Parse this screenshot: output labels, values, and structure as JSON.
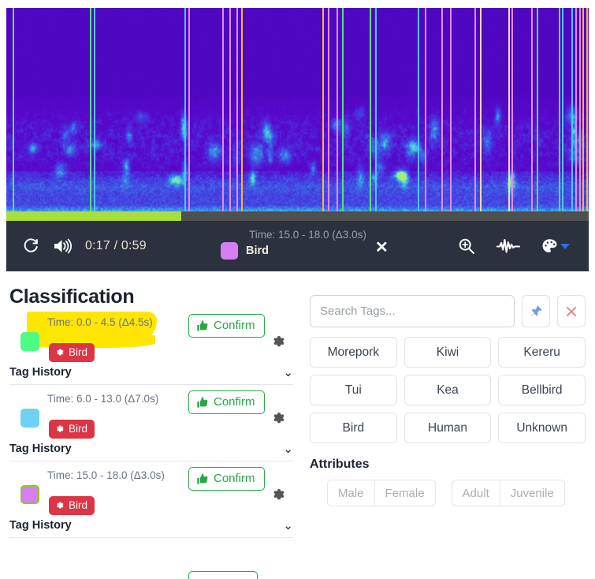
{
  "player": {
    "replay_icon": "replay-icon",
    "volume_icon": "volume-high-icon",
    "time_display": "0:17 / 0:59",
    "current_time": "0:17",
    "total_time": "0:59",
    "progress_percent": 30,
    "selection": {
      "time_label": "Time: 15.0 - 18.0 (Δ3.0s)",
      "tag_label": "Bird",
      "swatch_color": "#d77ff0",
      "clear_icon": "close-icon"
    },
    "tools": [
      {
        "name": "zoom-in-icon",
        "label": "Zoom"
      },
      {
        "name": "waveform-icon",
        "label": "Waveform"
      },
      {
        "name": "palette-icon",
        "label": "Colour map"
      }
    ],
    "regions": [
      {
        "left_pct": 1.1,
        "width_pct": 13.5,
        "color": "#58e27a"
      },
      {
        "left_pct": 15.0,
        "width_pct": 15.8,
        "color": "#4fc3f7"
      },
      {
        "left_pct": 31.2,
        "width_pct": 6.2,
        "color": "#e48ae8"
      },
      {
        "left_pct": 38.3,
        "width_pct": 1.5,
        "color": "#e48ae8"
      },
      {
        "left_pct": 40.3,
        "width_pct": 14.2,
        "color": "#ffb347"
      },
      {
        "left_pct": 55.2,
        "width_pct": 1.8,
        "color": "#e48ae8"
      },
      {
        "left_pct": 57.6,
        "width_pct": 5.0,
        "color": "#58e27a"
      },
      {
        "left_pct": 63.3,
        "width_pct": 7.6,
        "color": "#4fc3f7"
      },
      {
        "left_pct": 71.9,
        "width_pct": 3.1,
        "color": "#e48ae8"
      },
      {
        "left_pct": 76.2,
        "width_pct": 4.4,
        "color": "#e48ae8"
      },
      {
        "left_pct": 81.3,
        "width_pct": 5.2,
        "color": "#ffd9a0"
      },
      {
        "left_pct": 86.8,
        "width_pct": 3.6,
        "color": "#e48ae8"
      },
      {
        "left_pct": 91.1,
        "width_pct": 4.0,
        "color": "#58e27a"
      },
      {
        "left_pct": 95.4,
        "width_pct": 1.9,
        "color": "#4fc3f7"
      },
      {
        "left_pct": 97.7,
        "width_pct": 1.0,
        "color": "#e48ae8"
      },
      {
        "left_pct": 98.9,
        "width_pct": 0.9,
        "color": "#ffb347"
      }
    ]
  },
  "classification": {
    "title": "Classification",
    "rows": [
      {
        "time": "Time: 0.0 - 4.5 (Δ4.5s)",
        "tag": "Bird",
        "swatch_color": "#4dfc82",
        "selected": false,
        "highlighted": true,
        "confirm_label": "Confirm",
        "tag_history_label": "Tag History"
      },
      {
        "time": "Time: 6.0 - 13.0 (Δ7.0s)",
        "tag": "Bird",
        "swatch_color": "#6fd2f5",
        "selected": false,
        "highlighted": false,
        "confirm_label": "Confirm",
        "tag_history_label": "Tag History"
      },
      {
        "time": "Time: 15.0 - 18.0 (Δ3.0s)",
        "tag": "Bird",
        "swatch_color": "#d77ff0",
        "selected": true,
        "highlighted": false,
        "confirm_label": "Confirm",
        "tag_history_label": "Tag History"
      }
    ]
  },
  "tag_panel": {
    "search_placeholder": "Search Tags...",
    "search_value": "",
    "pin_icon": "pin-icon",
    "clear_icon": "close-icon",
    "tags": [
      "Morepork",
      "Kiwi",
      "Kereru",
      "Tui",
      "Kea",
      "Bellbird",
      "Bird",
      "Human",
      "Unknown"
    ],
    "attributes_title": "Attributes",
    "attribute_groups": [
      {
        "options": [
          "Male",
          "Female"
        ]
      },
      {
        "options": [
          "Adult",
          "Juvenile"
        ]
      }
    ]
  },
  "colors": {
    "accent_green": "#28a745",
    "danger_red": "#dc3545",
    "highlight_yellow": "#ffe600",
    "player_bg": "#2b313f",
    "progress_green": "#a8df3a",
    "pin_blue": "#6f9fe0"
  }
}
